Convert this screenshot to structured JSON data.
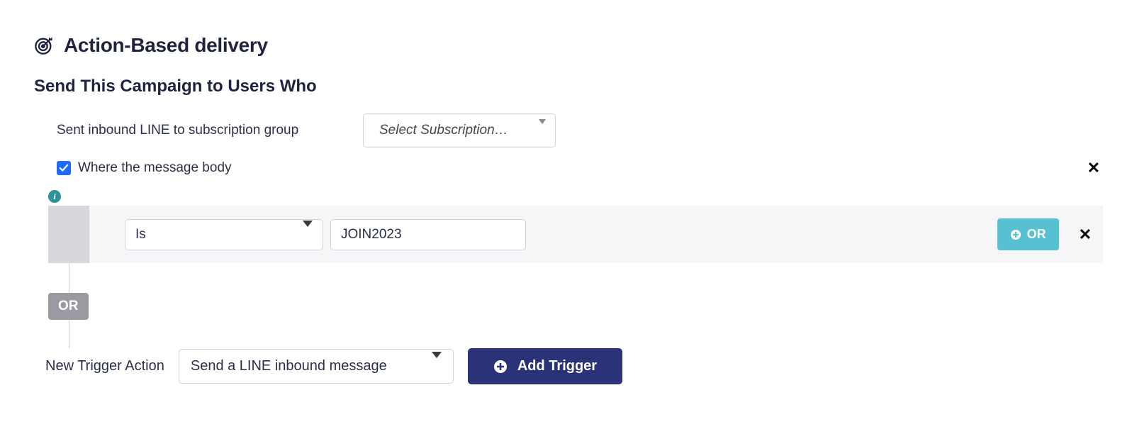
{
  "header": {
    "title": "Action-Based delivery"
  },
  "section": {
    "heading": "Send This Campaign to Users Who"
  },
  "trigger_condition": {
    "label": "Sent inbound LINE to subscription group",
    "subscription_select_placeholder": "Select Subscription…",
    "filter_checkbox_label": "Where the message body",
    "operator": "Is",
    "value": "JOIN2023",
    "or_pill_label": "OR"
  },
  "or_connector": {
    "label": "OR"
  },
  "new_trigger": {
    "label": "New Trigger Action",
    "select_value": "Send a LINE inbound message",
    "add_button_label": "Add Trigger"
  }
}
